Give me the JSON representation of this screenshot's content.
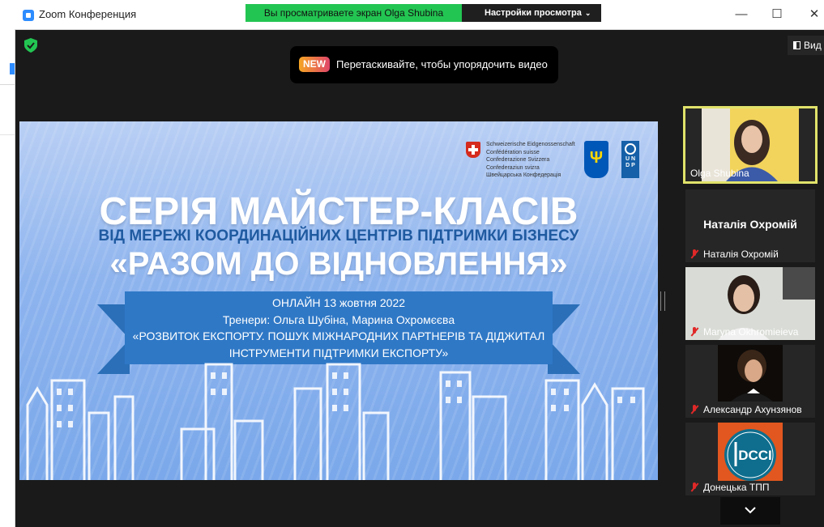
{
  "window": {
    "app_title": "Zoom Конференция",
    "minimize": "—",
    "maximize": "☐",
    "close": "✕"
  },
  "share": {
    "banner_text": "Вы просматриваете экран Olga  Shubina",
    "view_settings_label": "Настройки просмотра",
    "view_settings_chevron": "⌄"
  },
  "hint": {
    "badge": "NEW",
    "text": "Перетаскивайте, чтобы упорядочить видео"
  },
  "view_button": {
    "label": "Вид"
  },
  "slide": {
    "swiss_lines": [
      "Schweizerische Eidgenossenschaft",
      "Confédération suisse",
      "Confederazione Svizzera",
      "Confederaziun svizra",
      "Швейцарська Конфедерація"
    ],
    "undp_letters": [
      "U N",
      "D P"
    ],
    "title": "СЕРІЯ МАЙСТЕР-КЛАСІВ",
    "subtitle": "ВІД МЕРЕЖІ КООРДИНАЦІЙНИХ ЦЕНТРІВ ПІДТРИМКИ БІЗНЕСУ",
    "quote_title": "«РАЗОМ ДО ВІДНОВЛЕННЯ»",
    "banner_lines": [
      "ОНЛАЙН 13 жовтня 2022",
      "Тренери: Ольга Шубіна, Марина Охромєєва",
      "«РОЗВИТОК ЕКСПОРТУ. ПОШУК МІЖНАРОДНИХ ПАРТНЕРІВ ТА ДІДЖИТАЛ",
      "ІНСТРУМЕНТИ ПІДТРИМКИ ЕКСПОРТУ»"
    ]
  },
  "participants": [
    {
      "name": "Olga  Shubina",
      "muted": false,
      "active": true,
      "video": "woman-dark-hair"
    },
    {
      "name": "Наталія Охромій",
      "muted": true,
      "active": false,
      "video": "none",
      "center_name": "Наталія Охромій"
    },
    {
      "name": "Maryna Okhromieieva",
      "muted": true,
      "active": false,
      "video": "woman-headset"
    },
    {
      "name": "Александр Ахунзянов",
      "muted": true,
      "active": false,
      "video": "man-portrait"
    },
    {
      "name": "Донецька ТПП",
      "muted": true,
      "active": false,
      "video": "dcci-logo",
      "logo_text": "DCCI"
    }
  ],
  "colors": {
    "share_green": "#23c552",
    "active_border": "#e0e26a",
    "slide_blue": "#2f78c6",
    "muted_red": "#e02828"
  }
}
